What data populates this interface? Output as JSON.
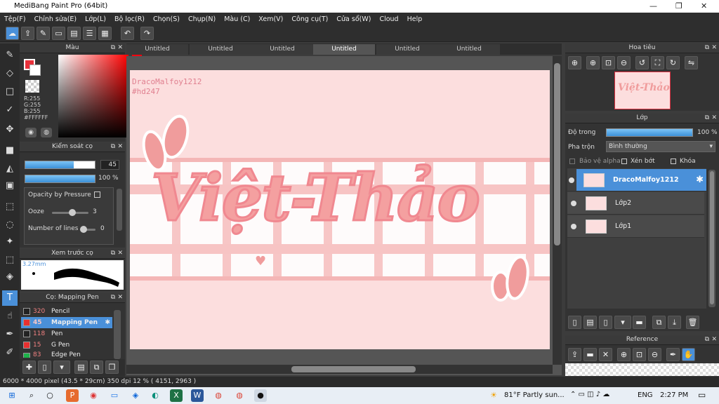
{
  "app": {
    "title": "MediBang Paint Pro (64bit)"
  },
  "window_controls": {
    "minimize": "—",
    "maximize": "❐",
    "close": "✕"
  },
  "menu": [
    "Tệp(F)",
    "Chỉnh sửa(E)",
    "Lớp(L)",
    "Bộ lọc(R)",
    "Chọn(S)",
    "Chụp(N)",
    "Màu (C)",
    "Xem(V)",
    "Công cụ(T)",
    "Cửa sổ(W)",
    "Cloud",
    "Help"
  ],
  "panels": {
    "color": {
      "title": "Màu",
      "r": "R:255",
      "g": "G:255",
      "b": "B:255",
      "hex": "#FFFFFF"
    },
    "brush_control": {
      "title": "Kiểm soát cọ",
      "size": "45",
      "opacity": "100 %",
      "opacity_by_pressure": "Opacity by Pressure",
      "ooze_label": "Ooze",
      "ooze_value": "3",
      "lines_label": "Number of lines",
      "lines_value": "0"
    },
    "brush_preview": {
      "title": "Xem trước cọ",
      "size": "3.27mm"
    },
    "brush_list": {
      "title": "Cọ: Mapping Pen",
      "items": [
        {
          "num": "320",
          "name": "Pencil",
          "color": "#222222"
        },
        {
          "num": "45",
          "name": "Mapping Pen",
          "color": "#e83030"
        },
        {
          "num": "118",
          "name": "Pen",
          "color": "#222222"
        },
        {
          "num": "15",
          "name": "G Pen",
          "color": "#e83030"
        },
        {
          "num": "83",
          "name": "Edge Pen",
          "color": "#1db34a"
        }
      ]
    },
    "navigator": {
      "title": "Hoa tiêu"
    },
    "layer": {
      "title": "Lớp",
      "opacity_label": "Độ trong",
      "opacity_value": "100 %",
      "blend_label": "Pha trộn",
      "blend_value": "Bình thường",
      "protect_alpha": "Bảo vệ alpha",
      "clipping": "Xén bớt",
      "lock": "Khóa",
      "layers": [
        {
          "name": "DracoMalfoy1212"
        },
        {
          "name": "Lớp2"
        },
        {
          "name": "Lớp1"
        }
      ]
    },
    "reference": {
      "title": "Reference"
    }
  },
  "tabs": [
    "Untitled",
    "Untitled",
    "Untitled",
    "Untitled",
    "Untitled",
    "Untitled"
  ],
  "canvas": {
    "credit": "DracoMalfoy1212",
    "tag": "#hd247",
    "art_text": "Việt-Thảo"
  },
  "status": {
    "text": "6000 * 4000 pixel  (43.5 * 29cm)  350 dpi  12 %  ( 4151, 2963 )"
  },
  "taskbar": {
    "weather": "81°F  Partly sun...",
    "lang": "ENG",
    "time": "2:27 PM"
  },
  "colors": {
    "accent": "#4a90d9",
    "canvas_bg": "#fcdede",
    "art": "#f4a0a0"
  }
}
